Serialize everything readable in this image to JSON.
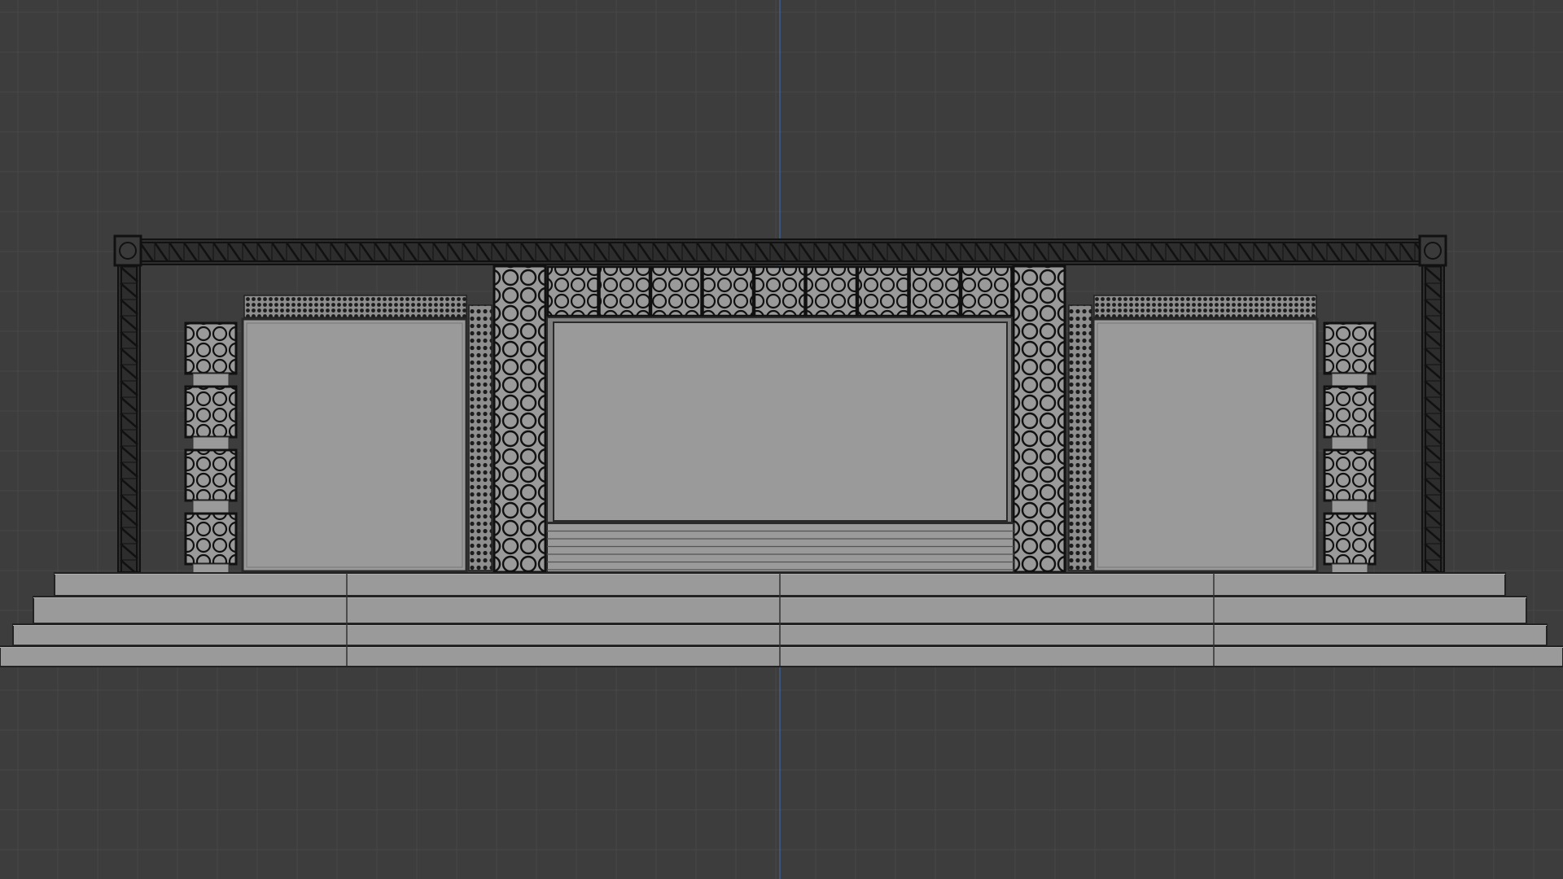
{
  "viewport": {
    "view": "front-orthographic",
    "grid": true,
    "background_color": "#3d3d3d",
    "grid_color": "#484848",
    "axis_line_color": "#3b5f8f",
    "surface_color": "#9a9a9a",
    "wire_color": "#1a1a1a"
  },
  "scene": {
    "object": "stage-set",
    "truss_frame": {
      "uprights": 2,
      "corner_blocks": 2
    },
    "screens": 3,
    "pixel_columns": 2,
    "header_panels": 9,
    "side_speaker_stacks": 2,
    "speaker_boxes_per_stack": 4,
    "center_riser_steps": 6,
    "stage_steps": 4
  }
}
